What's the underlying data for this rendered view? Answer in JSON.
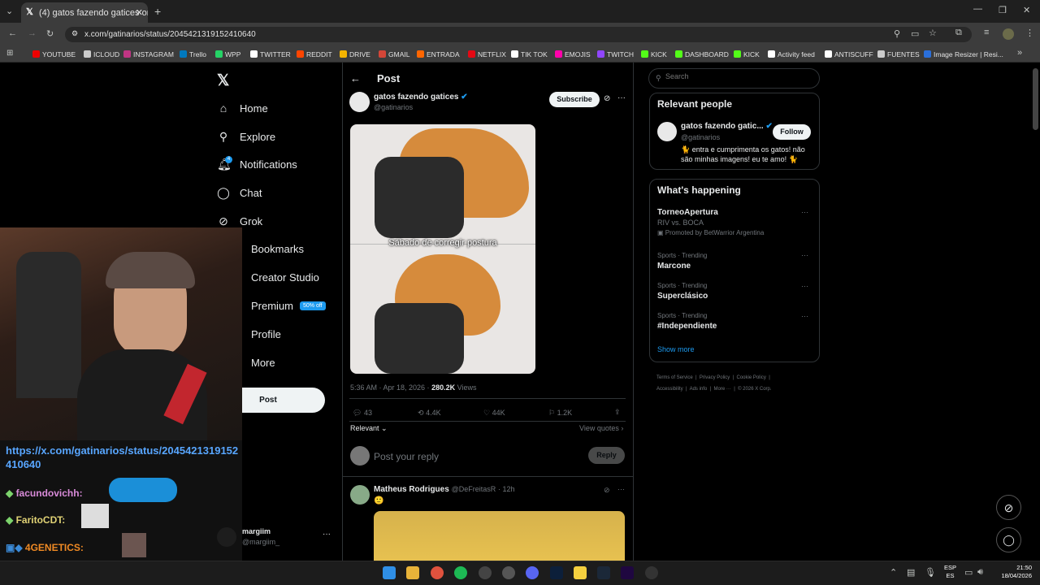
{
  "browser": {
    "tab_title": "(4) gatos fazendo gatices on X",
    "url": "x.com/gatinarios/status/2045421319152410640"
  },
  "bookmarks": [
    "YOUTUBE",
    "ICLOUD",
    "INSTAGRAM",
    "Trello",
    "WPP",
    "TWITTER",
    "REDDIT",
    "DRIVE",
    "GMAIL",
    "ENTRADA",
    "NETFLIX",
    "TIK TOK",
    "EMOJIS",
    "TWITCH",
    "KICK",
    "DASHBOARD",
    "KICK",
    "Activity feed",
    "ANTISCUFF",
    "FUENTES",
    "Image Resizer | Resi..."
  ],
  "nav": {
    "items": [
      "Home",
      "Explore",
      "Notifications",
      "Chat",
      "Grok",
      "Bookmarks",
      "Creator Studio",
      "Premium",
      "Profile",
      "More"
    ],
    "premium_badge": "50% off",
    "post_button": "Post",
    "notif_count": "4",
    "user_name": "margiim",
    "user_handle": "@margiim_"
  },
  "post": {
    "header": "Post",
    "author": "gatos fazendo gatices",
    "handle": "@gatinarios",
    "subscribe": "Subscribe",
    "image_caption": "Sábado de corregir postura",
    "time": "5:36 AM · Apr 18, 2026 ·",
    "views": "280.2K",
    "views_label": "Views",
    "replies": "43",
    "reposts": "4.4K",
    "likes": "44K",
    "bookmarks": "1.2K",
    "sort": "Relevant",
    "view_quotes": "View quotes",
    "reply_placeholder": "Post your reply",
    "reply_button": "Reply"
  },
  "reply": {
    "author": "Matheus Rodrigues",
    "handle": "@DeFreitasR",
    "time": "· 12h",
    "text": "🙂"
  },
  "search": {
    "placeholder": "Search"
  },
  "relevant": {
    "title": "Relevant people",
    "name": "gatos fazendo gatic...",
    "handle": "@gatinarios",
    "follow": "Follow",
    "bio": "🐈 entra e cumprimenta os gatos! não são minhas imagens! eu te amo! 🐈"
  },
  "happening": {
    "title": "What's happening",
    "trends": [
      {
        "name": "TorneoApertura",
        "sub": "RIV vs. BOCA",
        "promo": "Promoted by BetWarrior Argentina"
      },
      {
        "cat": "Sports · Trending",
        "name": "Marcone"
      },
      {
        "cat": "Sports · Trending",
        "name": "Superclásico"
      },
      {
        "cat": "Sports · Trending",
        "name": "#Independiente"
      }
    ],
    "show_more": "Show more"
  },
  "footer": [
    "Terms of Service",
    "Privacy Policy",
    "Cookie Policy",
    "Accessibility",
    "Ads info",
    "More ···",
    "© 2026 X Corp."
  ],
  "chat": {
    "link": "https://x.com/gatinarios/status/2045421319152410640",
    "user1": "facundovichh:",
    "user2": "FaritoCDT:",
    "user3": "4GENETICS:",
    "user4": "4GENETICS:",
    "prev": "FaritoCDT:"
  },
  "taskbar": {
    "lang1": "ESP",
    "lang2": "ES",
    "time": "21:50",
    "date": "18/04/2026"
  }
}
